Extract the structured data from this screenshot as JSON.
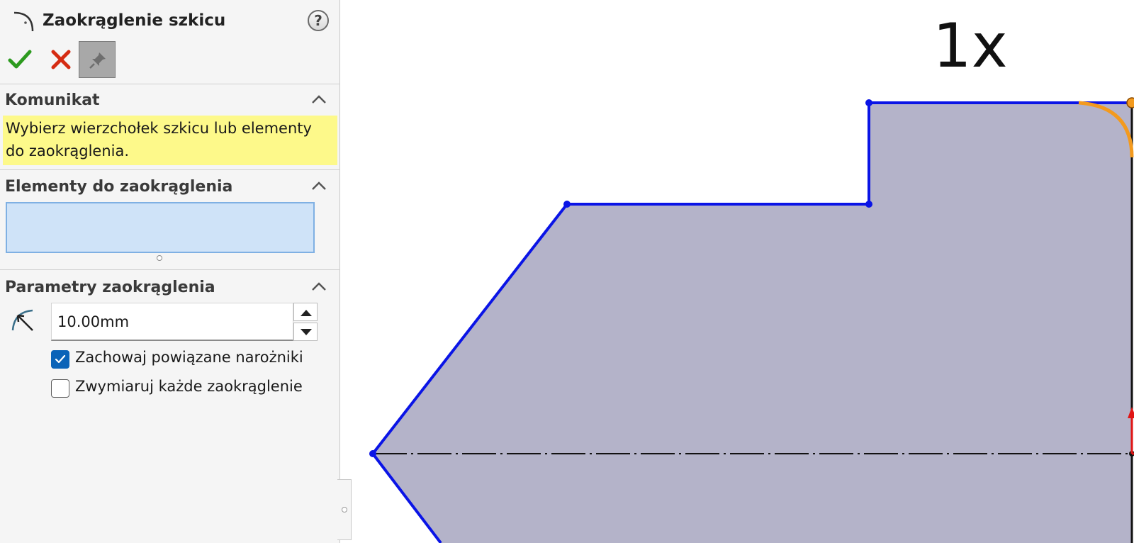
{
  "panel": {
    "title": "Zaokrąglenie szkicu",
    "help_label": "?",
    "message_section": {
      "title": "Komunikat",
      "text": "Wybierz wierzchołek szkicu lub elementy do zaokrąglenia."
    },
    "entities_section": {
      "title": "Elementy do zaokrąglenia"
    },
    "params_section": {
      "title": "Parametry zaokrąglenia",
      "radius_value": "10.00mm",
      "keep_corners_label": "Zachowaj powiązane narożniki",
      "keep_corners_checked": true,
      "dimension_each_label": "Zwymiaruj każde zaokrąglenie",
      "dimension_each_checked": false
    }
  },
  "viewport": {
    "zoom_label": "1x",
    "colors": {
      "sketch_line": "#0a14e6",
      "fill": "#b4b3c9",
      "fillet_preview": "#f39a1e",
      "axis_line": "#111111",
      "origin_y": "#e01515",
      "origin_x": "#e01515"
    }
  }
}
